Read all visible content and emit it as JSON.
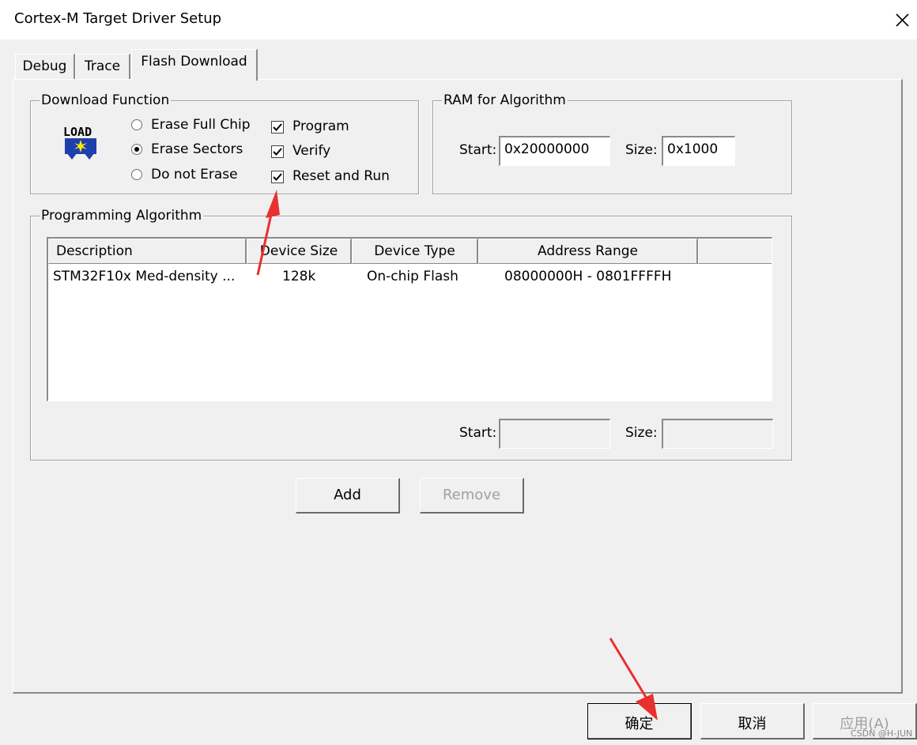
{
  "window": {
    "title": "Cortex-M Target Driver Setup"
  },
  "tabs": [
    {
      "label": "Debug"
    },
    {
      "label": "Trace"
    },
    {
      "label": "Flash Download",
      "active": true
    }
  ],
  "download_function": {
    "legend": "Download Function",
    "load_icon_text": "LOAD",
    "radios": [
      {
        "label": "Erase Full Chip",
        "selected": false
      },
      {
        "label": "Erase Sectors",
        "selected": true
      },
      {
        "label": "Do not Erase",
        "selected": false
      }
    ],
    "checkboxes": [
      {
        "label": "Program",
        "checked": true
      },
      {
        "label": "Verify",
        "checked": true
      },
      {
        "label": "Reset and Run",
        "checked": true
      }
    ]
  },
  "ram_for_algorithm": {
    "legend": "RAM for Algorithm",
    "start_label": "Start:",
    "start_value": "0x20000000",
    "size_label": "Size:",
    "size_value": "0x1000"
  },
  "programming_algorithm": {
    "legend": "Programming Algorithm",
    "columns": [
      "Description",
      "Device Size",
      "Device Type",
      "Address Range"
    ],
    "rows": [
      [
        "STM32F10x Med-density ...",
        "128k",
        "On-chip Flash",
        "08000000H - 0801FFFFH"
      ]
    ],
    "start_label": "Start:",
    "start_value": "",
    "size_label": "Size:",
    "size_value": ""
  },
  "buttons": {
    "add": "Add",
    "remove": "Remove",
    "ok": "确定",
    "cancel": "取消",
    "apply": "应用(A)"
  },
  "watermark": "CSDN @H-JUN",
  "colors": {
    "annotation_arrow": "#e8312f",
    "dialog_bg": "#f0f0f0"
  }
}
